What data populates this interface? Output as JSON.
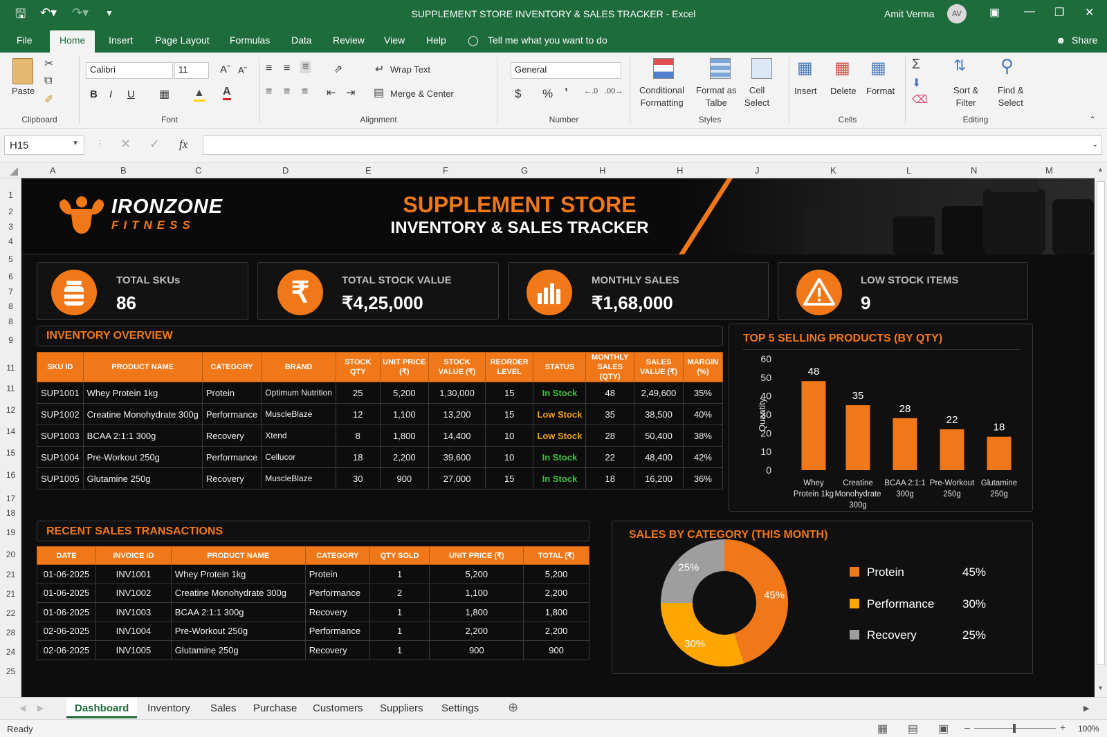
{
  "window": {
    "title": "SUPPLEMENT STORE INVENTORY & SALES TRACKER  -  Excel",
    "user": "Amit Verma",
    "avatar": "AV"
  },
  "menu": {
    "tabs": [
      "File",
      "Home",
      "Insert",
      "Page Layout",
      "Formulas",
      "Data",
      "Review",
      "View",
      "Help"
    ],
    "tell_me": "Tell me what you want to do",
    "share": "Share"
  },
  "ribbon": {
    "clipboard": {
      "paste": "Paste",
      "label": "Clipboard"
    },
    "font": {
      "name": "Calibri",
      "size": "11",
      "label": "Font",
      "bold": "B",
      "italic": "I",
      "underline": "U"
    },
    "alignment": {
      "wrap": "Wrap Text",
      "merge": "Merge & Center",
      "label": "Alignment"
    },
    "number": {
      "format": "General",
      "label": "Number",
      "currency": "$",
      "percent": "%",
      "comma": "’"
    },
    "styles": {
      "conditional": "Conditional\nFormatting",
      "format_as": "Format as\nTalbe",
      "cell": "Cell\nSelect",
      "label": "Styles"
    },
    "cells": {
      "insert": "Insert",
      "delete": "Delete",
      "format": "Format",
      "label": "Cells"
    },
    "editing": {
      "sort": "Sort &\nFilter",
      "find": "Find &\nSelect",
      "label": "Editing"
    }
  },
  "formula_bar": {
    "name_box": "H15",
    "fx": "fx",
    "value": ""
  },
  "columns": [
    "A",
    "B",
    "C",
    "D",
    "E",
    "F",
    "G",
    "H",
    "H",
    "J",
    "K",
    "L",
    "N",
    "M"
  ],
  "rows": [
    "1",
    "2",
    "3",
    "4",
    "5",
    "6",
    "7",
    "8",
    "8",
    "9",
    "11",
    "11",
    "12",
    "14",
    "15",
    "16",
    "17",
    "18",
    "19",
    "20",
    "21",
    "21",
    "22",
    "28",
    "24",
    "25"
  ],
  "brand": {
    "name": "IRONZONE",
    "sub": "FITNESS"
  },
  "header": {
    "title1": "SUPPLEMENT STORE",
    "title2": "INVENTORY & SALES TRACKER"
  },
  "kpis": [
    {
      "label": "TOTAL SKUs",
      "value": "86",
      "icon": "jar-icon"
    },
    {
      "label": "TOTAL STOCK VALUE",
      "value": "₹4,25,000",
      "icon": "rupee-icon"
    },
    {
      "label": "MONTHLY SALES",
      "value": "₹1,68,000",
      "icon": "bar-chart-icon"
    },
    {
      "label": "LOW STOCK ITEMS",
      "value": "9",
      "icon": "warning-icon"
    }
  ],
  "inventory": {
    "title": "INVENTORY OVERVIEW",
    "headers": [
      "SKU ID",
      "PRODUCT NAME",
      "CATEGORY",
      "BRAND",
      "STOCK QTY",
      "UNIT PRICE (₹)",
      "STOCK VALUE (₹)",
      "REORDER LEVEL",
      "STATUS",
      "MONTHLY SALES (QTY)",
      "SALES VALUE (₹)",
      "MARGIN (%)"
    ],
    "rows": [
      [
        "SUP1001",
        "Whey Protein 1kg",
        "Protein",
        "Optimum Nutrition",
        "25",
        "5,200",
        "1,30,000",
        "15",
        "In Stock",
        "48",
        "2,49,600",
        "35%"
      ],
      [
        "SUP1002",
        "Creatine Monohydrate 300g",
        "Performance",
        "MuscleBlaze",
        "12",
        "1,100",
        "13,200",
        "15",
        "Low Stock",
        "35",
        "38,500",
        "40%"
      ],
      [
        "SUP1003",
        "BCAA 2:1:1 300g",
        "Recovery",
        "Xtend",
        "8",
        "1,800",
        "14,400",
        "10",
        "Low Stock",
        "28",
        "50,400",
        "38%"
      ],
      [
        "SUP1004",
        "Pre-Workout 250g",
        "Performance",
        "Cellucor",
        "18",
        "2,200",
        "39,600",
        "10",
        "In Stock",
        "22",
        "48,400",
        "42%"
      ],
      [
        "SUP1005",
        "Glutamine 250g",
        "Recovery",
        "MuscleBlaze",
        "30",
        "900",
        "27,000",
        "15",
        "In Stock",
        "18",
        "16,200",
        "36%"
      ]
    ]
  },
  "transactions": {
    "title": "RECENT SALES TRANSACTIONS",
    "headers": [
      "DATE",
      "INVOICE ID",
      "PRODUCT NAME",
      "CATEGORY",
      "QTY SOLD",
      "UNIT PRICE (₹)",
      "TOTAL (₹)"
    ],
    "rows": [
      [
        "01-06-2025",
        "INV1001",
        "Whey Protein 1kg",
        "Protein",
        "1",
        "5,200",
        "5,200"
      ],
      [
        "01-06-2025",
        "INV1002",
        "Creatine Monohydrate 300g",
        "Performance",
        "2",
        "1,100",
        "2,200"
      ],
      [
        "01-06-2025",
        "INV1003",
        "BCAA 2:1:1 300g",
        "Recovery",
        "1",
        "1,800",
        "1,800"
      ],
      [
        "02-06-2025",
        "INV1004",
        "Pre-Workout 250g",
        "Performance",
        "1",
        "2,200",
        "2,200"
      ],
      [
        "02-06-2025",
        "INV1005",
        "Glutamine 250g",
        "Recovery",
        "1",
        "900",
        "900"
      ]
    ]
  },
  "chart_data": [
    {
      "type": "bar",
      "title": "TOP 5 SELLING PRODUCTS (BY QTY)",
      "ylabel": "Quantity",
      "xlabel": "",
      "categories": [
        "Whey\nProtein 1kg",
        "Creatine\nMonohydrate\n300g",
        "BCAA 2:1:1\n300g",
        "Pre-Workout\n250g",
        "Glutamine\n250g"
      ],
      "values": [
        48,
        35,
        28,
        22,
        18
      ],
      "ylim": [
        0,
        60
      ],
      "yticks": [
        "0",
        "10",
        "20",
        "30",
        "40",
        "50",
        "60"
      ],
      "color": "#f07818",
      "grid": false
    },
    {
      "type": "pie",
      "title": "SALES BY CATEGORY (THIS MONTH)",
      "donut": true,
      "labels": [
        "Protein",
        "Performance",
        "Recovery"
      ],
      "values": [
        45,
        30,
        25
      ],
      "value_labels": [
        "45%",
        "30%",
        "25%"
      ],
      "colors": [
        "#f07818",
        "#ffa500",
        "#9e9e9e"
      ],
      "legend": "right"
    }
  ],
  "sheets": [
    "Dashboard",
    "Inventory",
    "Sales",
    "Purchase",
    "Customers",
    "Suppliers",
    "Settings"
  ],
  "status": {
    "ready": "Ready",
    "zoom": "100%"
  },
  "colors": {
    "excel_green": "#1e6b3c",
    "accent": "#f07818",
    "in_stock": "#3fbf3f",
    "low_stock": "#f0a018"
  }
}
